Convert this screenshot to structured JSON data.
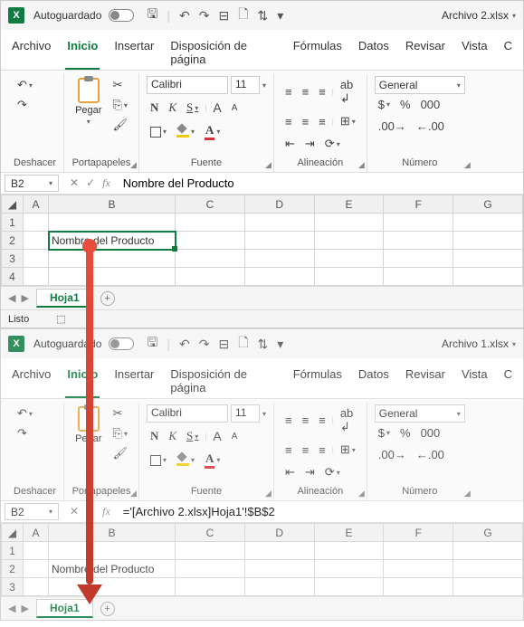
{
  "windows": [
    {
      "autosave_label": "Autoguardado",
      "filename": "Archivo 2.xlsx",
      "tabs": [
        "Archivo",
        "Inicio",
        "Insertar",
        "Disposición de página",
        "Fórmulas",
        "Datos",
        "Revisar",
        "Vista",
        "C"
      ],
      "active_tab": "Inicio",
      "groups": {
        "undo": "Deshacer",
        "clipboard": "Portapapeles",
        "paste": "Pegar",
        "font": "Fuente",
        "align": "Alineación",
        "number": "Número"
      },
      "font_name": "Calibri",
      "font_size": "11",
      "number_format": "General",
      "namebox": "B2",
      "formula": "Nombre del Producto",
      "columns": [
        "",
        "A",
        "B",
        "C",
        "D",
        "E",
        "F",
        "G"
      ],
      "rows": [
        "1",
        "2",
        "3",
        "4"
      ],
      "cell_b2": "Nombre del Producto",
      "sheet_tab": "Hoja1",
      "status": "Listo"
    },
    {
      "autosave_label": "Autoguardado",
      "filename": "Archivo 1.xlsx",
      "tabs": [
        "Archivo",
        "Inicio",
        "Insertar",
        "Disposición de página",
        "Fórmulas",
        "Datos",
        "Revisar",
        "Vista",
        "C"
      ],
      "active_tab": "Inicio",
      "groups": {
        "undo": "Deshacer",
        "clipboard": "Portapapeles",
        "paste": "Pegar",
        "font": "Fuente",
        "align": "Alineación",
        "number": "Número"
      },
      "font_name": "Calibri",
      "font_size": "11",
      "number_format": "General",
      "namebox": "B2",
      "formula": "='[Archivo 2.xlsx]Hoja1'!$B$2",
      "columns": [
        "",
        "A",
        "B",
        "C",
        "D",
        "E",
        "F",
        "G"
      ],
      "rows": [
        "1",
        "2",
        "3"
      ],
      "cell_b2": "Nombre del Producto",
      "sheet_tab": "Hoja1"
    }
  ],
  "font_style_labels": {
    "bold": "N",
    "italic": "K",
    "underline": "S",
    "fontcolor": "A"
  }
}
